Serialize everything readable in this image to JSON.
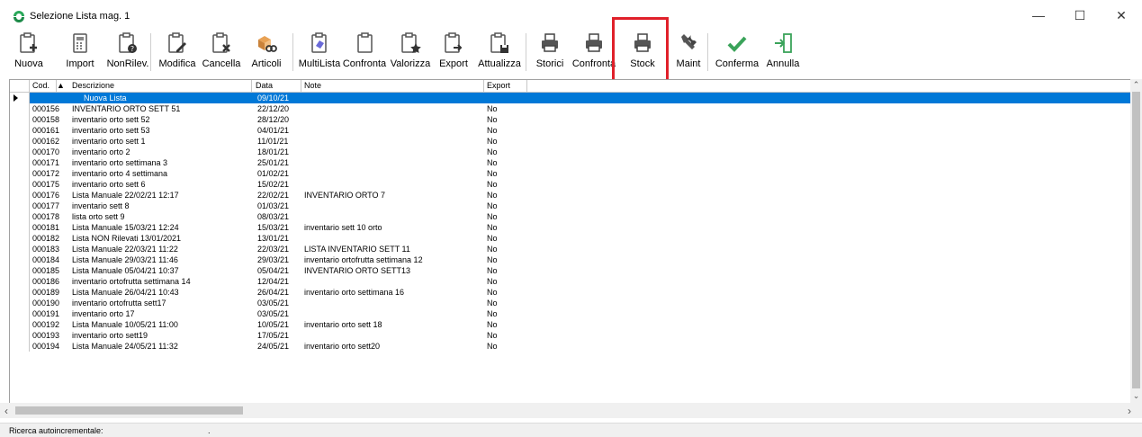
{
  "window": {
    "title": "Selezione Lista  mag. 1",
    "min_glyph": "—",
    "max_glyph": "☐",
    "close_glyph": "✕"
  },
  "toolbar": {
    "buttons": [
      {
        "label": "Nuova",
        "icon": "clipboard-plus-icon"
      },
      {
        "label": "Import",
        "icon": "calculator-icon"
      },
      {
        "label": "NonRilev.",
        "icon": "clipboard-help-icon"
      },
      {
        "label": "Modifica",
        "icon": "clipboard-edit-icon"
      },
      {
        "label": "Cancella",
        "icon": "clipboard-delete-icon"
      },
      {
        "label": "Articoli",
        "icon": "boxes-search-icon"
      },
      {
        "label": "MultiLista",
        "icon": "clipboard-multi-icon"
      },
      {
        "label": "Confronta",
        "icon": "clipboard-icon"
      },
      {
        "label": "Valorizza",
        "icon": "clipboard-star-icon"
      },
      {
        "label": "Export",
        "icon": "clipboard-export-icon"
      },
      {
        "label": "Attualizza",
        "icon": "clipboard-save-icon"
      },
      {
        "label": "Storici",
        "icon": "printer-icon"
      },
      {
        "label": "Confronta",
        "icon": "printer-icon"
      },
      {
        "label": "Stock",
        "icon": "printer-icon"
      },
      {
        "label": "Maint",
        "icon": "tools-icon"
      },
      {
        "label": "Conferma",
        "icon": "checkmark-icon"
      },
      {
        "label": "Annulla",
        "icon": "exit-door-icon"
      }
    ]
  },
  "grid": {
    "columns": {
      "cod": "Cod.",
      "descrizione": "Descrizione",
      "data": "Data",
      "note": "Note",
      "export": "Export"
    },
    "sort_glyph": "▲",
    "rows": [
      {
        "cod": "",
        "descrizione": "Nuova Lista",
        "data": "09/10/21",
        "note": "",
        "export": ""
      },
      {
        "cod": "000156",
        "descrizione": "INVENTARIO ORTO SETT 51",
        "data": "22/12/20",
        "note": "",
        "export": "No"
      },
      {
        "cod": "000158",
        "descrizione": "inventario orto sett 52",
        "data": "28/12/20",
        "note": "",
        "export": "No"
      },
      {
        "cod": "000161",
        "descrizione": "inventario orto sett 53",
        "data": "04/01/21",
        "note": "",
        "export": "No"
      },
      {
        "cod": "000162",
        "descrizione": "inventario orto sett 1",
        "data": "11/01/21",
        "note": "",
        "export": "No"
      },
      {
        "cod": "000170",
        "descrizione": "inventario orto 2",
        "data": "18/01/21",
        "note": "",
        "export": "No"
      },
      {
        "cod": "000171",
        "descrizione": "inventario orto settimana 3",
        "data": "25/01/21",
        "note": "",
        "export": "No"
      },
      {
        "cod": "000172",
        "descrizione": "inventario orto 4 settimana",
        "data": "01/02/21",
        "note": "",
        "export": "No"
      },
      {
        "cod": "000175",
        "descrizione": "inventario orto sett 6",
        "data": "15/02/21",
        "note": "",
        "export": "No"
      },
      {
        "cod": "000176",
        "descrizione": "Lista Manuale 22/02/21 12:17",
        "data": "22/02/21",
        "note": "INVENTARIO ORTO 7",
        "export": "No"
      },
      {
        "cod": "000177",
        "descrizione": "inventario sett 8",
        "data": "01/03/21",
        "note": "",
        "export": "No"
      },
      {
        "cod": "000178",
        "descrizione": "lista orto sett 9",
        "data": "08/03/21",
        "note": "",
        "export": "No"
      },
      {
        "cod": "000181",
        "descrizione": "Lista Manuale 15/03/21 12:24",
        "data": "15/03/21",
        "note": "inventario sett 10 orto",
        "export": "No"
      },
      {
        "cod": "000182",
        "descrizione": "Lista NON Rilevati 13/01/2021",
        "data": "13/01/21",
        "note": "",
        "export": "No"
      },
      {
        "cod": "000183",
        "descrizione": "Lista Manuale 22/03/21 11:22",
        "data": "22/03/21",
        "note": "LISTA INVENTARIO SETT 11",
        "export": "No"
      },
      {
        "cod": "000184",
        "descrizione": "Lista Manuale 29/03/21 11:46",
        "data": "29/03/21",
        "note": "inventario ortofrutta settimana 12",
        "export": "No"
      },
      {
        "cod": "000185",
        "descrizione": "Lista Manuale 05/04/21 10:37",
        "data": "05/04/21",
        "note": "INVENTARIO ORTO SETT13",
        "export": "No"
      },
      {
        "cod": "000186",
        "descrizione": "inventario ortofrutta settimana 14",
        "data": "12/04/21",
        "note": "",
        "export": "No"
      },
      {
        "cod": "000189",
        "descrizione": "Lista Manuale 26/04/21 10:43",
        "data": "26/04/21",
        "note": "inventario orto settimana 16",
        "export": "No"
      },
      {
        "cod": "000190",
        "descrizione": "inventario ortofrutta sett17",
        "data": "03/05/21",
        "note": "",
        "export": "No"
      },
      {
        "cod": "000191",
        "descrizione": "inventario orto 17",
        "data": "03/05/21",
        "note": "",
        "export": "No"
      },
      {
        "cod": "000192",
        "descrizione": "Lista Manuale 10/05/21 11:00",
        "data": "10/05/21",
        "note": "inventario orto sett 18",
        "export": "No"
      },
      {
        "cod": "000193",
        "descrizione": "inventario orto sett19",
        "data": "17/05/21",
        "note": "",
        "export": "No"
      },
      {
        "cod": "000194",
        "descrizione": "Lista Manuale 24/05/21 11:32",
        "data": "24/05/21",
        "note": "inventario orto sett20",
        "export": "No"
      }
    ]
  },
  "status": {
    "label": "Ricerca autoincrementale:",
    "value": "."
  },
  "colors": {
    "selection": "#0078d7",
    "highlight": "#e0202a",
    "check": "#3aa35a",
    "app_icon": "#2aa85a"
  }
}
